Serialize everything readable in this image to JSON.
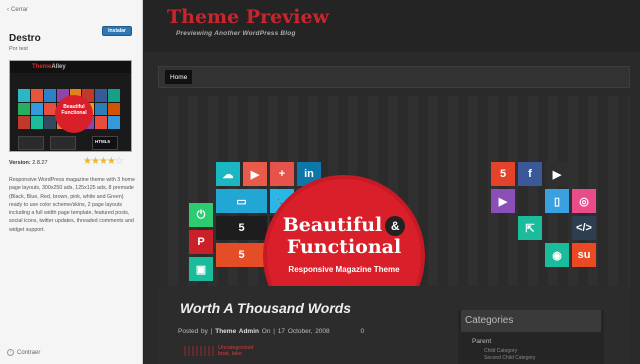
{
  "sidebar": {
    "close_label": "Cerrar",
    "install_label": "Instalar",
    "theme_name": "Destro",
    "theme_author": "Por test",
    "thumbnail": {
      "logo_red": "Theme",
      "logo_grey": "Alley",
      "circle_text": "Beautiful Functional",
      "box_text": "HTML5"
    },
    "version_label": "Version:",
    "version_value": "2.8.27",
    "rating_stars": 4,
    "description": "Responsive WordPress magazine theme with 3 home page layouts, 300x250 ads, 125x125 ads, 8 premade (Black, Blue, Red, brown, pink, white and Green) ready to use color scheme/skins, 2 page layouts including a full width page template, featured posts, social icons, twitter updates, threaded comments and widget support.",
    "collapse_label": "Contraer"
  },
  "preview": {
    "site_title": "Theme Preview",
    "site_tagline": "Previewing Another WordPress Blog",
    "nav_home": "Home",
    "slider": {
      "title_line1": "Beautiful",
      "amp": "&",
      "title_line2": "Functional",
      "subtitle": "Responsive Magazine Theme"
    },
    "post": {
      "title": "Worth A Thousand Words",
      "meta_posted_by": "Posted by",
      "meta_author": "Theme Admin",
      "meta_on": "On",
      "meta_date": "17 October, 2008",
      "meta_comments": "0",
      "categories": "Uncategorized\nboat, lake"
    },
    "widget": {
      "title": "Categories",
      "parent": "Parent",
      "children": "Child Category\nSecond Child Category"
    }
  },
  "colors": {
    "accent": "#c8262d",
    "install_button": "#2f78b4",
    "star": "#e8b833"
  }
}
